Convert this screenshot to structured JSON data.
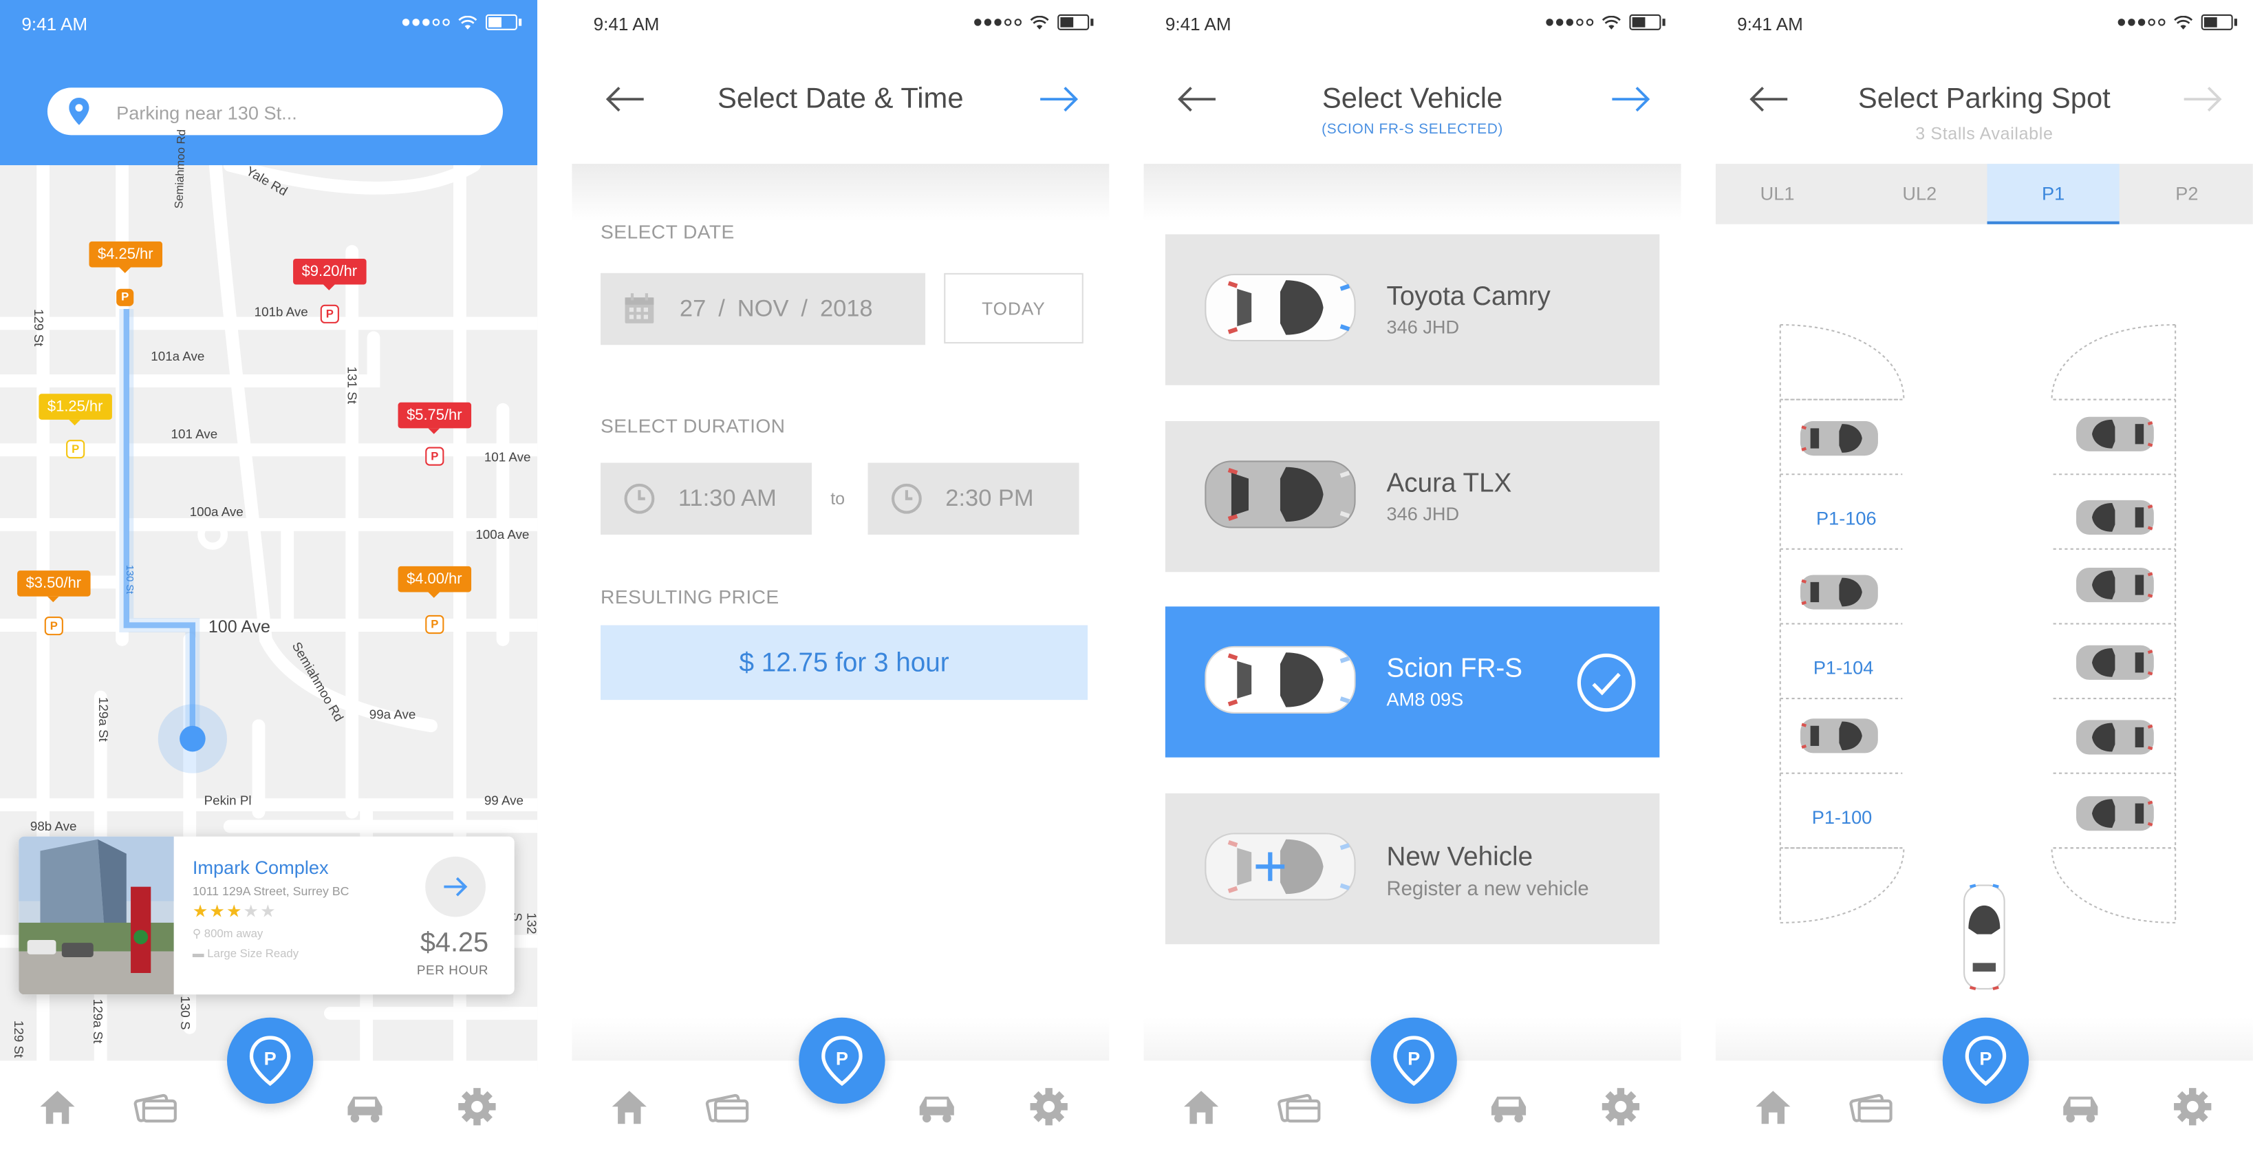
{
  "status": {
    "time": "9:41 AM"
  },
  "screen_map": {
    "search": {
      "placeholder": "Parking near 130 St..."
    },
    "streets": {
      "yale": "Yale Rd",
      "semiahmoo_top": "Semiahmoo Rd",
      "s129": "129 St",
      "a101b": "101b Ave",
      "a101a": "101a Ave",
      "s131": "131 St",
      "a101": "101 Ave",
      "a101_right": "101 Ave",
      "a100a": "100a Ave",
      "a100a_right": "100a Ave",
      "a100": "100 Ave",
      "semiahmoo": "Semiahmoo Rd",
      "a99a": "99a Ave",
      "s129a": "129a St",
      "pekin": "Pekin Pl",
      "a99": "99 Ave",
      "a98b": "98b Ave",
      "s129_bottom": "129 St",
      "s129a_bottom": "129a St",
      "s130_bottom": "130 S",
      "s132_right": "132 S",
      "route_130": "130 St"
    },
    "price_tags": [
      {
        "label": "$4.25/hr",
        "color": "#f28b0c"
      },
      {
        "label": "$9.20/hr",
        "color": "#e8333a"
      },
      {
        "label": "$1.25/hr",
        "color": "#f5c50f"
      },
      {
        "label": "$5.75/hr",
        "color": "#e8333a"
      },
      {
        "label": "$3.50/hr",
        "color": "#f28b0c"
      },
      {
        "label": "$4.00/hr",
        "color": "#f28b0c"
      }
    ],
    "parking_mark": "P",
    "card": {
      "name": "Impark Complex",
      "address": "1011 129A Street, Surrey BC",
      "rating": 3,
      "rating_max": 5,
      "stars_filled": "★★★",
      "stars_empty": "★★",
      "distance": "800m away",
      "size": "Large Size Ready",
      "price": "$4.25",
      "per": "PER HOUR"
    }
  },
  "screen_datetime": {
    "title": "Select Date & Time",
    "select_date_label": "SELECT DATE",
    "date": {
      "day": "27",
      "month": "NOV",
      "year": "2018",
      "sep": "/"
    },
    "today_button": "TODAY",
    "select_duration_label": "SELECT DURATION",
    "start_time": "11:30 AM",
    "to": "to",
    "end_time": "2:30 PM",
    "resulting_price_label": "RESULTING PRICE",
    "price_text": "$ 12.75 for 3 hour"
  },
  "screen_vehicle": {
    "title": "Select Vehicle",
    "subtitle": "(SCION FR-S SELECTED)",
    "vehicles": [
      {
        "name": "Toyota Camry",
        "plate": "346 JHD",
        "selected": false
      },
      {
        "name": "Acura TLX",
        "plate": "346 JHD",
        "selected": false
      },
      {
        "name": "Scion FR-S",
        "plate": "AM8 09S",
        "selected": true
      },
      {
        "name": "New Vehicle",
        "plate": "Register a new vehicle",
        "selected": false
      }
    ]
  },
  "screen_spot": {
    "title": "Select Parking Spot",
    "subtitle": "3 Stalls Available",
    "levels": [
      "UL1",
      "UL2",
      "P1",
      "P2"
    ],
    "active_level": "P1",
    "stalls": [
      "P1-106",
      "P1-104",
      "P1-100"
    ]
  },
  "tabbar": {
    "icons": [
      "home-icon",
      "cards-icon",
      "parking-pin-icon",
      "car-icon",
      "gear-icon"
    ]
  },
  "colors": {
    "accent": "#4a9bf7",
    "selected_bg": "#4a9bf7",
    "price_bg": "#d6e9fd",
    "orange": "#f28b0c",
    "red": "#e8333a",
    "yellow": "#f5c50f"
  }
}
